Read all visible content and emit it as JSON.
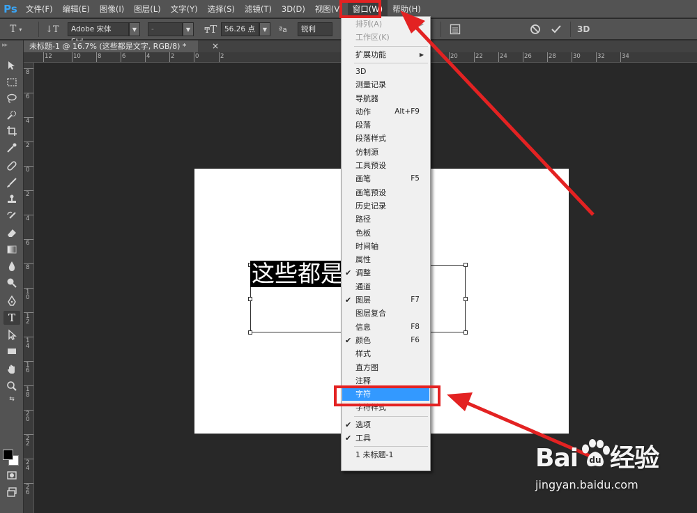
{
  "app": {
    "logo": "Ps"
  },
  "menubar": {
    "items": [
      {
        "label": "文件(F)"
      },
      {
        "label": "编辑(E)"
      },
      {
        "label": "图像(I)"
      },
      {
        "label": "图层(L)"
      },
      {
        "label": "文字(Y)"
      },
      {
        "label": "选择(S)"
      },
      {
        "label": "滤镜(T)"
      },
      {
        "label": "3D(D)"
      },
      {
        "label": "视图(V)"
      },
      {
        "label": "窗口(W)",
        "active": true
      },
      {
        "label": "帮助(H)"
      }
    ]
  },
  "options": {
    "font_family": "Adobe 宋体 Std",
    "font_style": "-",
    "font_size": "56.26 点",
    "aa_label": "ªa",
    "antialias": "锐利"
  },
  "document": {
    "tab_title": "未标题-1 @ 16.7% (这些都是文字, RGB/8) *",
    "close": "×",
    "visible_text": "这些都是"
  },
  "rulers": {
    "top": [
      "12",
      "10",
      "8",
      "6",
      "4",
      "2",
      "0",
      "2",
      "20",
      "22",
      "24",
      "26",
      "28",
      "30",
      "32",
      "34"
    ],
    "left": [
      "8",
      "6",
      "4",
      "2",
      "0",
      "2",
      "4",
      "6",
      "8",
      "10",
      "12",
      "14",
      "16",
      "18",
      "20",
      "22",
      "24",
      "26"
    ]
  },
  "window_menu": {
    "items": [
      {
        "label": "排列(A)",
        "disabled": true,
        "submenu": true
      },
      {
        "label": "工作区(K)",
        "disabled": true
      },
      {
        "sep": true
      },
      {
        "label": "扩展功能",
        "submenu": true
      },
      {
        "sep": true
      },
      {
        "label": "3D"
      },
      {
        "label": "测量记录"
      },
      {
        "label": "导航器"
      },
      {
        "label": "动作",
        "shortcut": "Alt+F9"
      },
      {
        "label": "段落"
      },
      {
        "label": "段落样式"
      },
      {
        "label": "仿制源"
      },
      {
        "label": "工具预设"
      },
      {
        "label": "画笔",
        "shortcut": "F5"
      },
      {
        "label": "画笔预设"
      },
      {
        "label": "历史记录"
      },
      {
        "label": "路径"
      },
      {
        "label": "色板"
      },
      {
        "label": "时间轴"
      },
      {
        "label": "属性"
      },
      {
        "label": "调整",
        "checked": true
      },
      {
        "label": "通道"
      },
      {
        "label": "图层",
        "checked": true,
        "shortcut": "F7"
      },
      {
        "label": "图层复合"
      },
      {
        "label": "信息",
        "shortcut": "F8"
      },
      {
        "label": "颜色",
        "checked": true,
        "shortcut": "F6"
      },
      {
        "label": "样式"
      },
      {
        "label": "直方图"
      },
      {
        "label": "注释"
      },
      {
        "label": "字符",
        "highlighted": true
      },
      {
        "label": "字符样式"
      },
      {
        "sep": true
      },
      {
        "label": "选项",
        "checked": true
      },
      {
        "label": "工具",
        "checked": true
      },
      {
        "sep": true
      },
      {
        "label": "1 未标题-1"
      }
    ]
  },
  "check_mark": "✔",
  "submenu_arrow": "▶",
  "watermark": {
    "logo_left": "Bai",
    "logo_right": "经验",
    "url": "jingyan.baidu.com"
  },
  "colors": {
    "annotation": "#e32222",
    "highlight": "#3399ff"
  }
}
